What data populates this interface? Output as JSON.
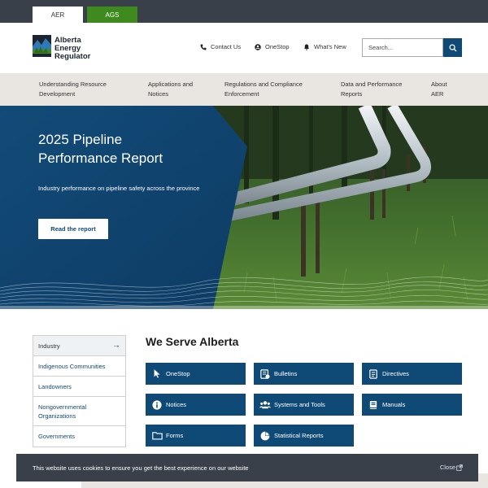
{
  "topbar": {
    "tabs": [
      "AER",
      "AGS"
    ]
  },
  "logo": {
    "line1": "Alberta",
    "line2": "Energy",
    "line3": "Regulator"
  },
  "header_links": {
    "contact": "Contact Us",
    "onestop": "OneStop",
    "whatsnew": "What's New"
  },
  "search": {
    "placeholder": "Search..."
  },
  "nav": [
    {
      "line1": "Understanding Resource",
      "line2": "Development"
    },
    {
      "line1": "Applications and",
      "line2": "Notices"
    },
    {
      "line1": "Regulations and Compliance",
      "line2": "Enforcement"
    },
    {
      "line1": "Data and Performance",
      "line2": "Reports"
    },
    {
      "line1": "About",
      "line2": "AER"
    }
  ],
  "hero": {
    "title_line1": "2025 Pipeline",
    "title_line2": "Performance Report",
    "subtitle": "Industry performance on pipeline safety across the province",
    "button": "Read the report"
  },
  "side_menu": [
    "Industry",
    "Indigenous Communities",
    "Landowners",
    "Nongovernmental Organizations",
    "Governments"
  ],
  "serve": {
    "title": "We Serve Alberta",
    "tiles": [
      {
        "label": "OneStop",
        "icon": "cursor-icon"
      },
      {
        "label": "Bulletins",
        "icon": "bulletin-icon"
      },
      {
        "label": "Directives",
        "icon": "document-icon"
      },
      {
        "label": "Notices",
        "icon": "info-icon"
      },
      {
        "label": "Systems and Tools",
        "icon": "users-icon"
      },
      {
        "label": "Manuals",
        "icon": "book-icon"
      },
      {
        "label": "Forms",
        "icon": "folder-icon"
      },
      {
        "label": "Statistical Reports",
        "icon": "pie-chart-icon"
      }
    ]
  },
  "cookie": {
    "message": "This website uses cookies to ensure you get the best experience on our website",
    "close": "Close"
  },
  "colors": {
    "brand_blue": "#0f4a76",
    "dark_bar": "#3a404a",
    "ags_green": "#3e8a1f",
    "nav_bg": "#e9e5e0"
  }
}
